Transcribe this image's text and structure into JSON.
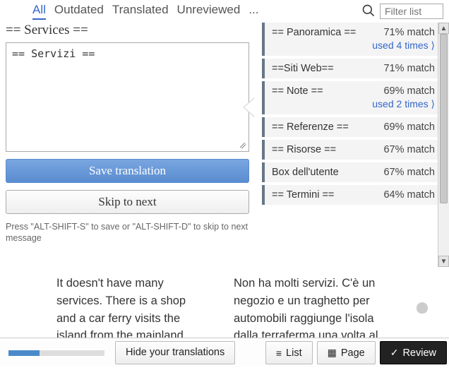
{
  "tabs": {
    "all": "All",
    "outdated": "Outdated",
    "translated": "Translated",
    "unreviewed": "Unreviewed",
    "more": "..."
  },
  "filter": {
    "placeholder": "Filter list"
  },
  "source": {
    "heading": "== Services =="
  },
  "editor": {
    "value": "== Servizi =="
  },
  "buttons": {
    "save": "Save translation",
    "skip": "Skip to next",
    "hide": "Hide your translations",
    "list": "List",
    "page": "Page",
    "review": "Review"
  },
  "hint": "Press \"ALT-SHIFT-S\" to save or \"ALT-SHIFT-D\" to skip to next message",
  "suggestions": [
    {
      "title": "== Panoramica ==",
      "pct": "71% match",
      "used": "used 4 times ⟩"
    },
    {
      "title": "==Siti Web==",
      "pct": "71% match"
    },
    {
      "title": "== Note ==",
      "pct": "69% match",
      "used": "used 2 times ⟩"
    },
    {
      "title": "== Referenze ==",
      "pct": "69% match"
    },
    {
      "title": "== Risorse ==",
      "pct": "67% match"
    },
    {
      "title": "Box dell'utente",
      "pct": "67% match"
    },
    {
      "title": "== Termini ==",
      "pct": "64% match"
    }
  ],
  "context": {
    "source": "It doesn't have many services. There is a shop and a car ferry visits the island from the mainland",
    "target": "Non ha molti servizi. C'è un negozio e un traghetto per automobili raggiunge l'isola dalla terraferma una volta al"
  },
  "progress": {
    "percent": 32
  }
}
